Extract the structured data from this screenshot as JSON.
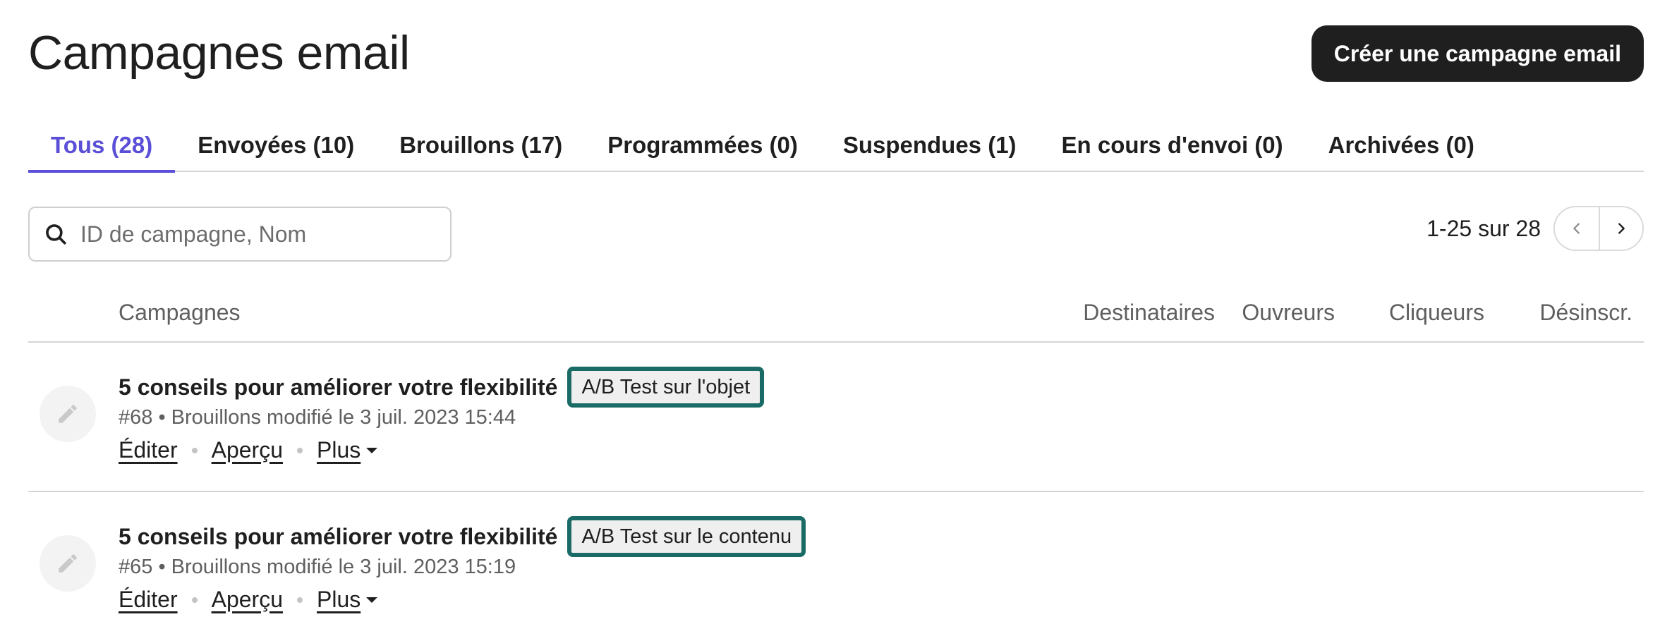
{
  "header": {
    "title": "Campagnes email",
    "create_button": "Créer une campagne email"
  },
  "tabs": [
    {
      "label": "Tous (28)",
      "active": true
    },
    {
      "label": "Envoyées (10)",
      "active": false
    },
    {
      "label": "Brouillons (17)",
      "active": false
    },
    {
      "label": "Programmées (0)",
      "active": false
    },
    {
      "label": "Suspendues (1)",
      "active": false
    },
    {
      "label": "En cours d'envoi (0)",
      "active": false
    },
    {
      "label": "Archivées (0)",
      "active": false
    }
  ],
  "search": {
    "placeholder": "ID de campagne, Nom",
    "value": ""
  },
  "pagination": {
    "info": "1-25 sur 28"
  },
  "table": {
    "columns": {
      "campaigns": "Campagnes",
      "recipients": "Destinataires",
      "openers": "Ouvreurs",
      "clickers": "Cliqueurs",
      "unsubscribes": "Désinscr."
    },
    "rows": [
      {
        "title": "5 conseils pour améliorer votre flexibilité",
        "badge": "A/B Test sur l'objet",
        "meta": "#68 • Brouillons modifié le 3 juil. 2023 15:44",
        "edit": "Éditer",
        "preview": "Aperçu",
        "more": "Plus"
      },
      {
        "title": "5 conseils pour améliorer votre flexibilité",
        "badge": "A/B Test sur le contenu",
        "meta": "#65 • Brouillons modifié le 3 juil. 2023 15:19",
        "edit": "Éditer",
        "preview": "Aperçu",
        "more": "Plus"
      }
    ]
  },
  "colors": {
    "accent": "#5a4fd6",
    "badge_border": "#1a6b66",
    "primary_button": "#1f1f1f"
  },
  "icons": {
    "search": "search-icon",
    "pencil": "pencil-icon",
    "prev": "chevron-left-icon",
    "next": "chevron-right-icon",
    "caret": "caret-down-icon"
  }
}
